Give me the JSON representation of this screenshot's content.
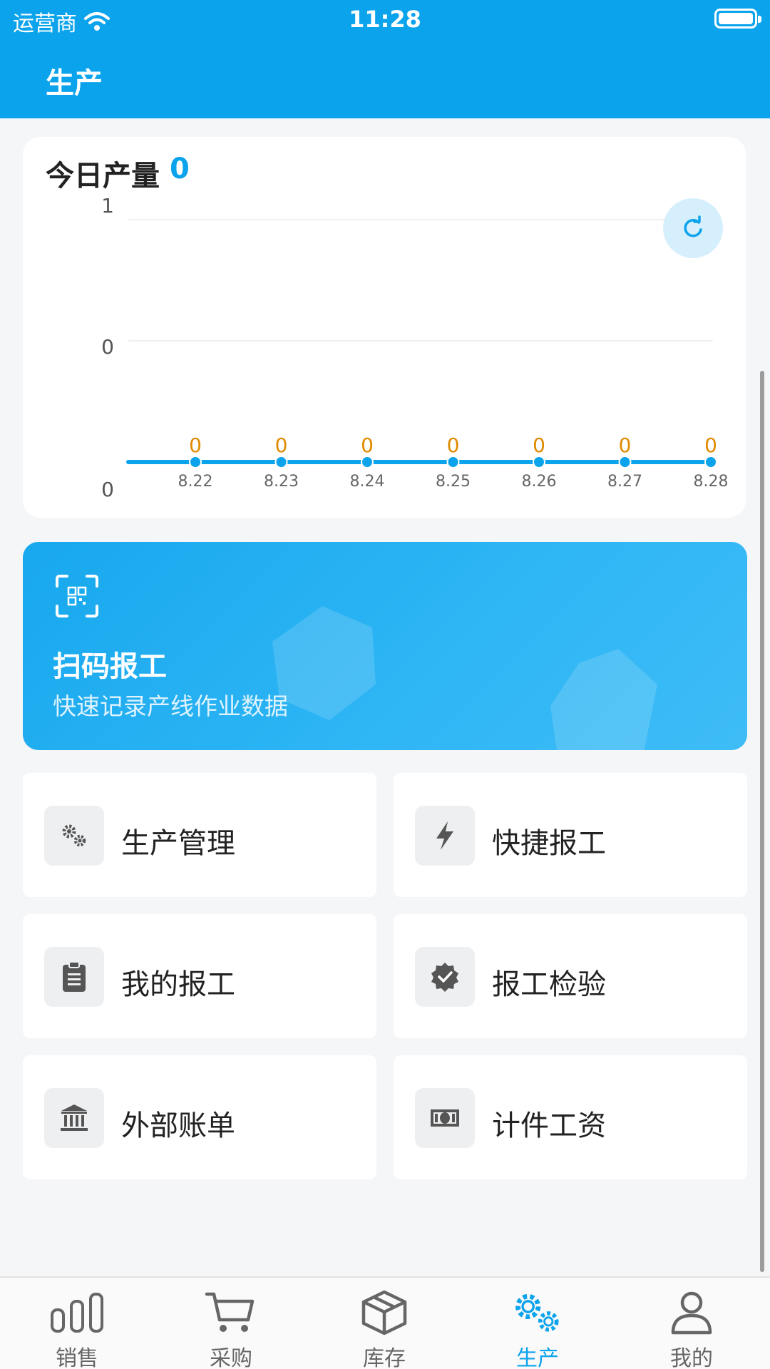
{
  "status_bar": {
    "carrier": "运营商",
    "time": "11:28"
  },
  "header": {
    "title": "生产"
  },
  "production": {
    "label": "今日产量",
    "today_value": "0"
  },
  "chart_data": {
    "type": "line",
    "categories": [
      "8.22",
      "8.23",
      "8.24",
      "8.25",
      "8.26",
      "8.27",
      "8.28"
    ],
    "values": [
      0,
      0,
      0,
      0,
      0,
      0,
      0
    ],
    "data_labels": [
      "0",
      "0",
      "0",
      "0",
      "0",
      "0",
      "0"
    ],
    "y_tick_labels": [
      "1",
      "0",
      "0"
    ],
    "series_color": "#0aa3ec",
    "label_color": "#e08a00",
    "grid": true
  },
  "scan_banner": {
    "title": "扫码报工",
    "subtitle": "快速记录产线作业数据"
  },
  "tiles": [
    {
      "label": "生产管理",
      "icon": "gears-icon"
    },
    {
      "label": "快捷报工",
      "icon": "bolt-icon"
    },
    {
      "label": "我的报工",
      "icon": "clipboard-icon"
    },
    {
      "label": "报工检验",
      "icon": "check-badge-icon"
    },
    {
      "label": "外部账单",
      "icon": "bank-icon"
    },
    {
      "label": "计件工资",
      "icon": "money-icon"
    }
  ],
  "bottom_nav": [
    {
      "label": "销售",
      "icon": "bar-chart-icon",
      "active": false
    },
    {
      "label": "采购",
      "icon": "cart-icon",
      "active": false
    },
    {
      "label": "库存",
      "icon": "box-icon",
      "active": false
    },
    {
      "label": "生产",
      "icon": "gears-icon",
      "active": true
    },
    {
      "label": "我的",
      "icon": "user-icon",
      "active": false
    }
  ],
  "colors": {
    "primary": "#0aa3ec",
    "background": "#f5f6f8"
  }
}
